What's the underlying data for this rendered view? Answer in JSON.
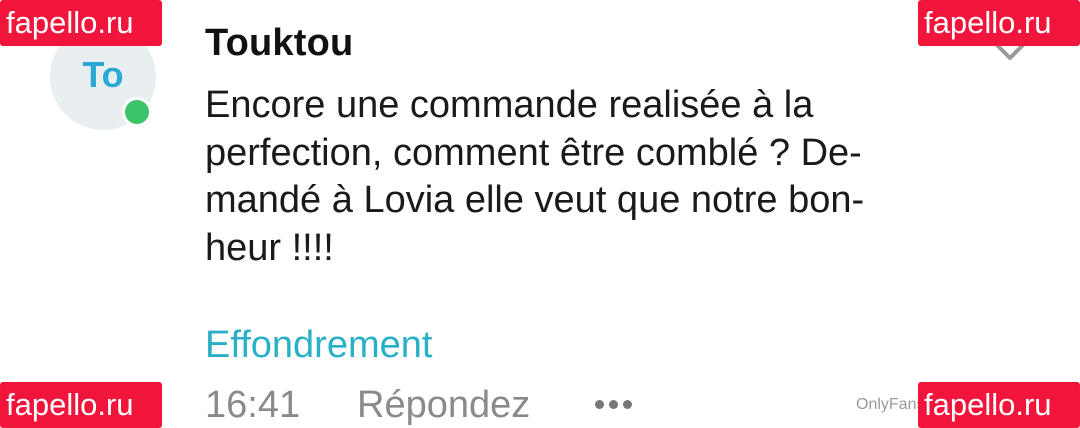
{
  "watermark": {
    "text": "fapello.ru"
  },
  "comment": {
    "avatar_initials": "To",
    "username": "Touktou",
    "message_lines": [
      "Encore une commande realisée à la",
      "perfection, comment être comblé ? De-",
      "mandé à Lovia elle veut que notre bon-",
      "heur !!!!"
    ],
    "tag": "Effondrement",
    "time": "16:41",
    "reply_label": "Répondez"
  },
  "credit": "OnlyFans",
  "icons": {
    "online": "online-status-dot",
    "more": "more-dots-icon",
    "expand": "chevron-down-icon"
  },
  "colors": {
    "accent": "#2ab0c6",
    "online": "#3cc46b",
    "watermark_bg": "#f2153b",
    "avatar_bg": "#e9eef0"
  }
}
